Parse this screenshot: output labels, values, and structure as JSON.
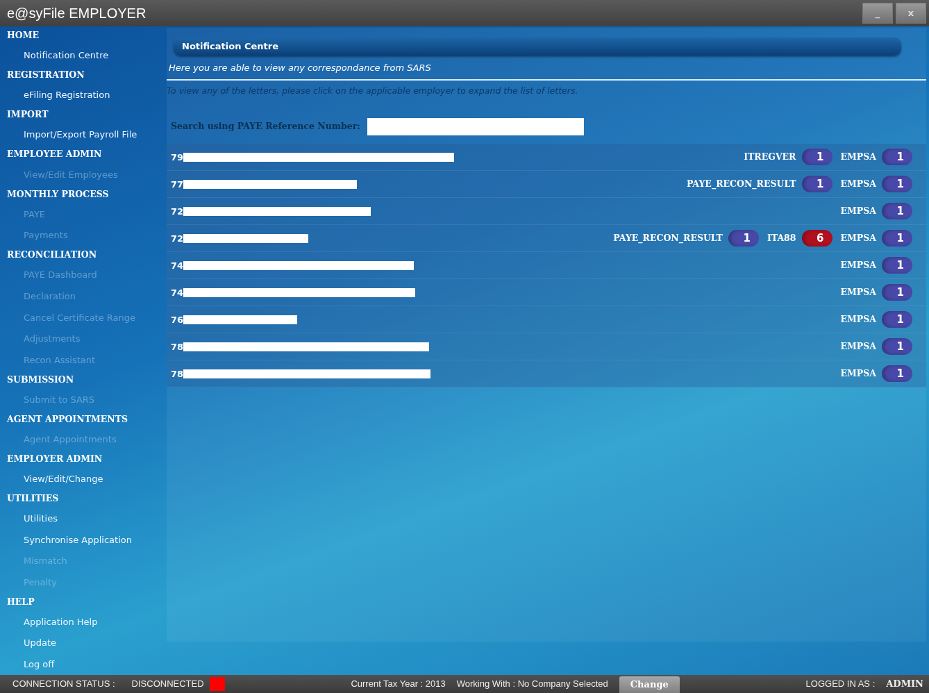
{
  "window": {
    "title": "e@syFile EMPLOYER",
    "controls": [
      "_",
      "x"
    ]
  },
  "sidebar": [
    {
      "heading": "HOME",
      "items": [
        {
          "label": "Notification Centre",
          "disabled": false
        }
      ]
    },
    {
      "heading": "REGISTRATION",
      "items": [
        {
          "label": "eFiling Registration",
          "disabled": false
        }
      ]
    },
    {
      "heading": "IMPORT",
      "items": [
        {
          "label": "Import/Export Payroll File",
          "disabled": false
        }
      ]
    },
    {
      "heading": "EMPLOYEE ADMIN",
      "items": [
        {
          "label": "View/Edit Employees",
          "disabled": true
        }
      ]
    },
    {
      "heading": "MONTHLY PROCESS",
      "items": [
        {
          "label": "PAYE",
          "disabled": true
        },
        {
          "label": "Payments",
          "disabled": true
        }
      ]
    },
    {
      "heading": "RECONCILIATION",
      "items": [
        {
          "label": "PAYE Dashboard",
          "disabled": true
        },
        {
          "label": "Declaration",
          "disabled": true
        },
        {
          "label": "Cancel Certificate Range",
          "disabled": true
        },
        {
          "label": "Adjustments",
          "disabled": true
        },
        {
          "label": "Recon Assistant",
          "disabled": true
        }
      ]
    },
    {
      "heading": "SUBMISSION",
      "items": [
        {
          "label": "Submit to SARS",
          "disabled": true
        }
      ]
    },
    {
      "heading": "AGENT APPOINTMENTS",
      "items": [
        {
          "label": "Agent Appointments",
          "disabled": true
        }
      ]
    },
    {
      "heading": "EMPLOYER ADMIN",
      "items": [
        {
          "label": "View/Edit/Change",
          "disabled": false
        }
      ]
    },
    {
      "heading": "UTILITIES",
      "items": [
        {
          "label": "Utilities",
          "disabled": false
        },
        {
          "label": "Synchronise Application",
          "disabled": false
        },
        {
          "label": "Mismatch",
          "disabled": true
        },
        {
          "label": "Penalty",
          "disabled": true
        }
      ]
    },
    {
      "heading": "HELP",
      "items": [
        {
          "label": "Application Help",
          "disabled": false
        },
        {
          "label": "Update",
          "disabled": false
        },
        {
          "label": "Log off",
          "disabled": false
        }
      ]
    }
  ],
  "panel": {
    "title": "Notification Centre",
    "subtitle": "Here you are able to view any correspondance from SARS",
    "instruction": "To view any of the letters, please click on the applicable employer to expand the list of letters.",
    "search_label": "Search using PAYE Reference Number:"
  },
  "employers": [
    {
      "reference": "79",
      "letters": [
        {
          "type": "ITREGVER",
          "count": "1",
          "color": "#4848a8"
        },
        {
          "type": "EMPSA",
          "count": "1",
          "color": "#4848a8"
        }
      ]
    },
    {
      "reference": "77",
      "letters": [
        {
          "type": "PAYE_RECON_RESULT",
          "count": "1",
          "color": "#4848a8"
        },
        {
          "type": "EMPSA",
          "count": "1",
          "color": "#4848a8"
        }
      ]
    },
    {
      "reference": "72",
      "letters": [
        {
          "type": "EMPSA",
          "count": "1",
          "color": "#4848a8"
        }
      ]
    },
    {
      "reference": "72",
      "letters": [
        {
          "type": "PAYE_RECON_RESULT",
          "count": "1",
          "color": "#4848a8"
        },
        {
          "type": "ITA88",
          "count": "6",
          "color": "#b01020"
        },
        {
          "type": "EMPSA",
          "count": "1",
          "color": "#4848a8"
        }
      ]
    },
    {
      "reference": "74",
      "letters": [
        {
          "type": "EMPSA",
          "count": "1",
          "color": "#4848a8"
        }
      ]
    },
    {
      "reference": "74",
      "letters": [
        {
          "type": "EMPSA",
          "count": "1",
          "color": "#4848a8"
        }
      ]
    },
    {
      "reference": "76",
      "letters": [
        {
          "type": "EMPSA",
          "count": "1",
          "color": "#4848a8"
        }
      ]
    },
    {
      "reference": "78",
      "letters": [
        {
          "type": "EMPSA",
          "count": "1",
          "color": "#4848a8"
        }
      ]
    },
    {
      "reference": "78",
      "letters": [
        {
          "type": "EMPSA",
          "count": "1",
          "color": "#4848a8"
        }
      ]
    }
  ],
  "status_bar": {
    "connection_label": "CONNECTION STATUS :",
    "connection_value": "DISCONNECTED",
    "connected": false,
    "tax_year": "Current Tax Year : 2013",
    "working_with": "Working With : No Company Selected",
    "change_button": "Change",
    "logged_in_label": "LOGGED IN AS :",
    "user": "ADMIN"
  }
}
